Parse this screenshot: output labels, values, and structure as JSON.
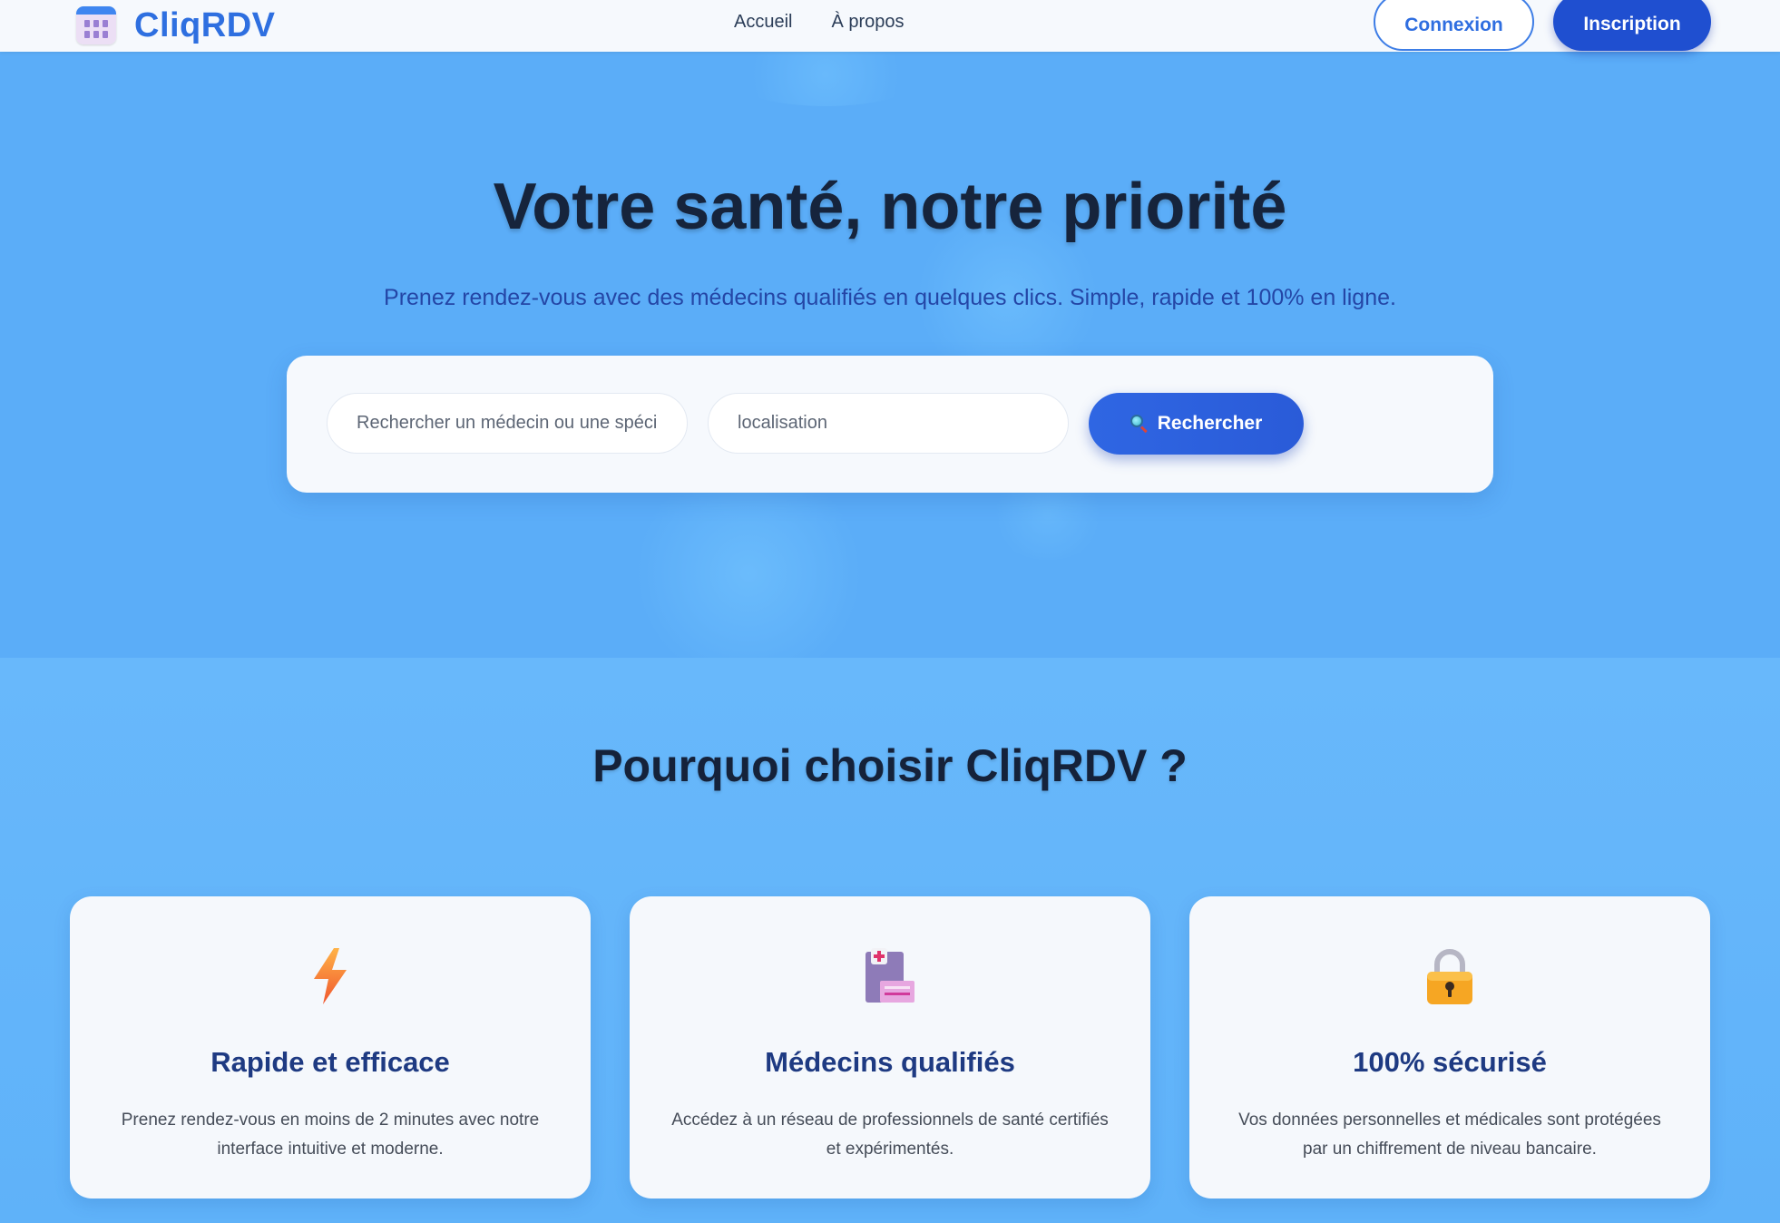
{
  "brand": {
    "name": "CliqRDV",
    "logo_icon": "calendar-icon"
  },
  "nav": {
    "links": [
      "Accueil",
      "À propos"
    ],
    "login_label": "Connexion",
    "signup_label": "Inscription"
  },
  "hero": {
    "title": "Votre santé, notre priorité",
    "subtitle": "Prenez rendez-vous avec des médecins qualifiés en quelques clics. Simple, rapide et 100% en ligne.",
    "search": {
      "doctor_placeholder": "Rechercher un médecin ou une spécialité",
      "location_placeholder": "localisation",
      "button_label": "Rechercher",
      "button_icon": "magnifier-icon"
    }
  },
  "why": {
    "title": "Pourquoi choisir CliqRDV ?",
    "cards": [
      {
        "icon": "lightning-icon",
        "title": "Rapide et efficace",
        "text": "Prenez rendez-vous en moins de 2 minutes avec notre interface intuitive et moderne."
      },
      {
        "icon": "medical-record-icon",
        "title": "Médecins qualifiés",
        "text": "Accédez à un réseau de professionnels de santé certifiés et expérimentés."
      },
      {
        "icon": "lock-icon",
        "title": "100% sécurisé",
        "text": "Vos données personnelles et médicales sont protégées par un chiffrement de niveau bancaire."
      }
    ]
  },
  "colors": {
    "primary": "#2e6fe0",
    "button_dark": "#1f4fd0",
    "hero_bg": "#5badf8",
    "card_title": "#1e3a82"
  }
}
